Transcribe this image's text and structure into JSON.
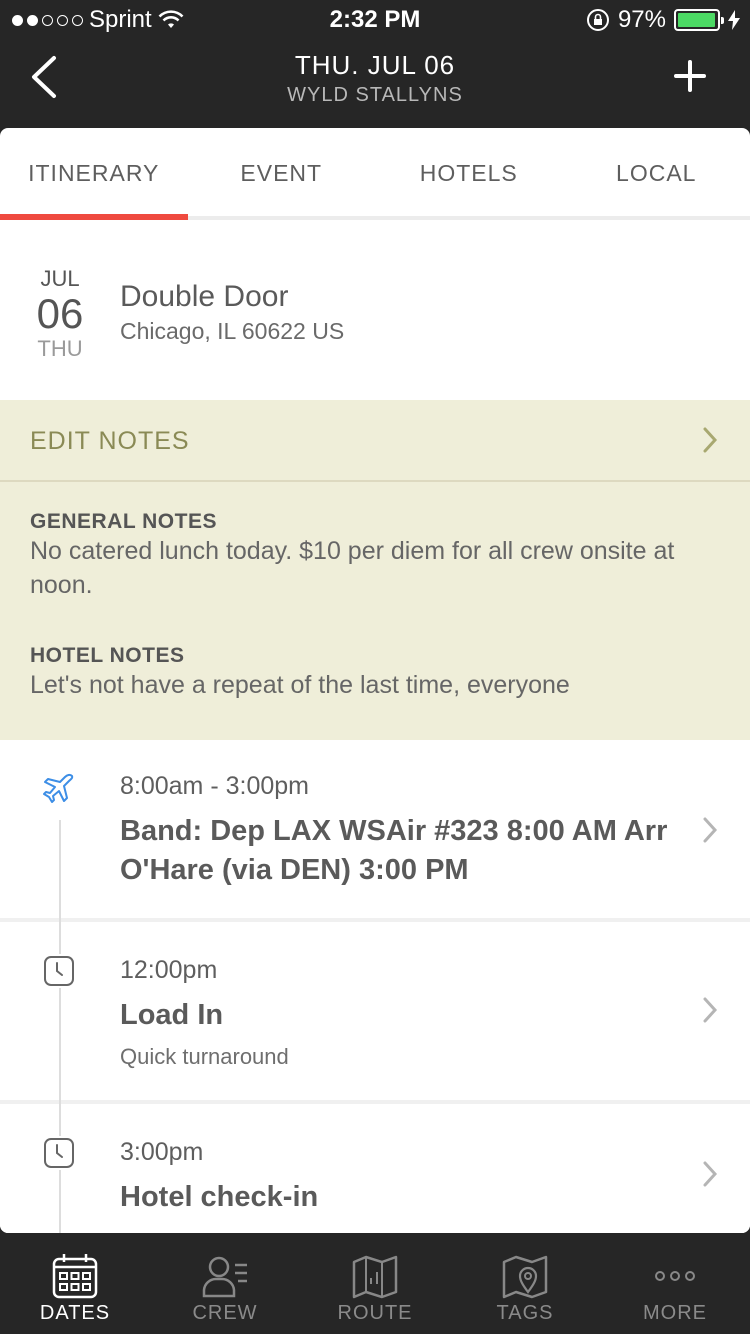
{
  "status_bar": {
    "carrier": "Sprint",
    "time": "2:32 PM",
    "battery": "97%",
    "battery_level": 0.97
  },
  "header": {
    "title": "THU. JUL 06",
    "subtitle": "WYLD STALLYNS",
    "back_icon": "chevron-left-icon",
    "add_icon": "plus-icon"
  },
  "tabs": [
    {
      "label": "ITINERARY",
      "active": true
    },
    {
      "label": "EVENT",
      "active": false
    },
    {
      "label": "HOTELS",
      "active": false
    },
    {
      "label": "LOCAL",
      "active": false
    }
  ],
  "venue": {
    "month": "JUL",
    "day": "06",
    "weekday": "THU",
    "name": "Double Door",
    "address": "Chicago, IL 60622 US"
  },
  "notes": {
    "edit_label": "EDIT NOTES",
    "general_heading": "GENERAL NOTES",
    "general_text": "No catered lunch today. $10 per diem for all crew onsite at noon.",
    "hotel_heading": "HOTEL NOTES",
    "hotel_text": "Let's not have a repeat of the last time, everyone"
  },
  "itinerary": [
    {
      "icon": "airplane-icon",
      "time": "8:00am - 3:00pm",
      "title": "Band: Dep LAX WSAir #323 8:00 AM Arr O'Hare (via DEN) 3:00 PM",
      "subtitle": ""
    },
    {
      "icon": "clock-icon",
      "time": "12:00pm",
      "title": "Load In",
      "subtitle": "Quick turnaround"
    },
    {
      "icon": "clock-icon",
      "time": "3:00pm",
      "title": "Hotel check-in",
      "subtitle": ""
    }
  ],
  "tabbar": [
    {
      "label": "DATES",
      "icon": "calendar-icon",
      "active": true
    },
    {
      "label": "CREW",
      "icon": "crew-icon",
      "active": false
    },
    {
      "label": "ROUTE",
      "icon": "map-icon",
      "active": false
    },
    {
      "label": "TAGS",
      "icon": "map-pin-icon",
      "active": false
    },
    {
      "label": "MORE",
      "icon": "more-icon",
      "active": false
    }
  ],
  "colors": {
    "accent": "#ef4a3f",
    "notes_bg": "#efeed9",
    "notes_accent": "#8a8a55",
    "flight_icon": "#3d8ee6",
    "battery": "#4cd964"
  }
}
